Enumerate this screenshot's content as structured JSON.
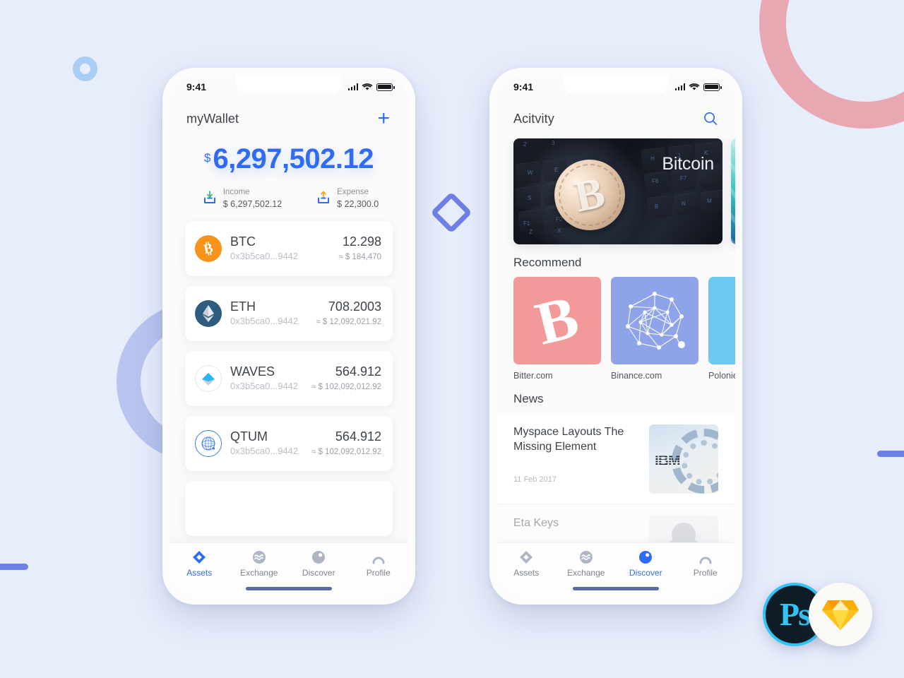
{
  "background": {
    "color": "#e8edfb",
    "decorations": [
      {
        "name": "ring-pink",
        "color": "#e8a8b2"
      },
      {
        "name": "ring-purple",
        "color": "#b9c4ef"
      },
      {
        "name": "ring-small-blue",
        "color": "#a8cef5"
      },
      {
        "name": "diamond",
        "color": "#6d80e8"
      },
      {
        "name": "bar-left",
        "color": "#6d80e8"
      },
      {
        "name": "bar-right",
        "color": "#6d80e8"
      }
    ]
  },
  "app_badges": [
    {
      "name": "photoshop-badge",
      "label": "Ps",
      "accent": "#31c5f4",
      "bg": "#0d1c25"
    },
    {
      "name": "sketch-badge",
      "label": "",
      "accent": "#fdad00",
      "bg": "#fbfaf7"
    }
  ],
  "accent": "#2f6bf5",
  "status_bar": {
    "time": "9:41"
  },
  "wallet_screen": {
    "header": {
      "title": "myWallet",
      "add_label": "+"
    },
    "balance": {
      "currency": "$",
      "amount": "6,297,502.12"
    },
    "flows": [
      {
        "label": "Income",
        "value": "$ 6,297,502.12",
        "icon": "income-icon",
        "arrow_color": "#3cb878"
      },
      {
        "label": "Expense",
        "value": "$ 22,300.0",
        "icon": "expense-icon",
        "arrow_color": "#f5a623"
      }
    ],
    "assets": [
      {
        "symbol": "BTC",
        "address": "0x3b5ca0...9442",
        "quantity": "12.298",
        "fiat": "≈ $ 184,470",
        "icon_bg": "#f7931a",
        "icon": "btc-icon"
      },
      {
        "symbol": "ETH",
        "address": "0x3b5ca0...9442",
        "quantity": "708.2003",
        "fiat": "≈ $ 12,092,021.92",
        "icon_bg": "#2d5c7f",
        "icon": "eth-icon"
      },
      {
        "symbol": "WAVES",
        "address": "0x3b5ca0...9442",
        "quantity": "564.912",
        "fiat": "≈ $ 102,092,012.92",
        "icon_bg": "#ffffff",
        "icon": "waves-icon"
      },
      {
        "symbol": "QTUM",
        "address": "0x3b5ca0...9442",
        "quantity": "564.912",
        "fiat": "≈ $ 102,092,012.92",
        "icon_bg": "#ffffff",
        "icon": "qtum-icon"
      }
    ],
    "tabs": [
      {
        "label": "Assets",
        "icon": "assets-icon",
        "active": true
      },
      {
        "label": "Exchange",
        "icon": "exchange-icon",
        "active": false
      },
      {
        "label": "Discover",
        "icon": "discover-icon",
        "active": false
      },
      {
        "label": "Profile",
        "icon": "profile-icon",
        "active": false
      }
    ]
  },
  "discover_screen": {
    "header": {
      "title": "Acitvity",
      "search_icon": "search-icon"
    },
    "banners": [
      {
        "caption": "Bitcoin",
        "name": "banner-bitcoin-keyboard"
      },
      {
        "caption": "",
        "name": "banner-teal"
      }
    ],
    "recommend": {
      "title": "Recommend",
      "items": [
        {
          "name": "Bitter.com",
          "color": "#f29a99",
          "icon": "bitcoin-glyph"
        },
        {
          "name": "Binance.com",
          "color": "#8fa3e8",
          "icon": "network-graph-icon"
        },
        {
          "name": "Poloniex",
          "color": "#6ec9f2",
          "icon": "poloniex-icon"
        }
      ]
    },
    "news": {
      "title": "News",
      "items": [
        {
          "title": "Myspace Layouts The Missing Element",
          "date": "11 Feb 2017",
          "thumb": "ibm-thumb"
        },
        {
          "title": "Eta Keys",
          "date": "",
          "thumb": "avatar-thumb"
        }
      ]
    },
    "tabs": [
      {
        "label": "Assets",
        "icon": "assets-icon",
        "active": false
      },
      {
        "label": "Exchange",
        "icon": "exchange-icon",
        "active": false
      },
      {
        "label": "Discover",
        "icon": "discover-icon",
        "active": true
      },
      {
        "label": "Profile",
        "icon": "profile-icon",
        "active": false
      }
    ]
  }
}
